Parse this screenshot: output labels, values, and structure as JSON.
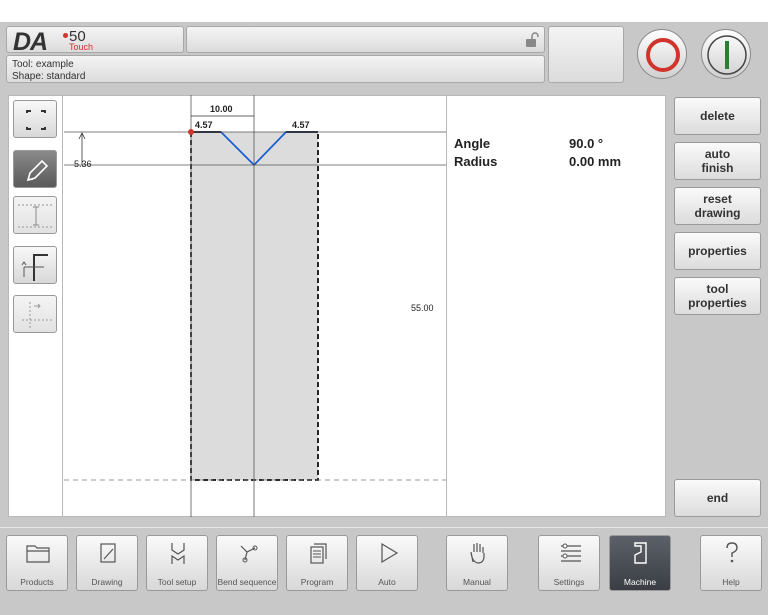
{
  "header": {
    "logo_main": "DA",
    "logo_model": "50",
    "logo_sub": "Touch",
    "tool_line": "Tool: example",
    "shape_line": "Shape: standard"
  },
  "drawing": {
    "dim_top": "10.00",
    "dim_left": "4.57",
    "dim_right": "4.57",
    "dim_depth": "5.36",
    "dim_height": "55.00"
  },
  "properties": {
    "angle_label": "Angle",
    "angle_value": "90.0 °",
    "radius_label": "Radius",
    "radius_value": "0.00 mm"
  },
  "side_buttons": {
    "delete": "delete",
    "auto_finish": "auto finish",
    "reset_drawing": "reset drawing",
    "properties": "properties",
    "tool_properties": "tool properties",
    "end": "end"
  },
  "nav": [
    {
      "label": "Products",
      "icon": "folder-icon"
    },
    {
      "label": "Drawing",
      "icon": "drawing-icon"
    },
    {
      "label": "Tool setup",
      "icon": "tool-setup-icon"
    },
    {
      "label": "Bend sequence",
      "icon": "bend-sequence-icon"
    },
    {
      "label": "Program",
      "icon": "program-icon"
    },
    {
      "label": "Auto",
      "icon": "play-icon"
    },
    {
      "label": "Manual",
      "icon": "hand-icon"
    },
    {
      "label": "Settings",
      "icon": "settings-icon"
    },
    {
      "label": "Machine",
      "icon": "machine-icon"
    },
    {
      "label": "Help",
      "icon": "help-icon"
    }
  ],
  "colors": {
    "accent_red": "#d0342c",
    "start_green": "#2e7d32",
    "profile_blue": "#1a5fd0",
    "active_nav": "#474b52"
  }
}
